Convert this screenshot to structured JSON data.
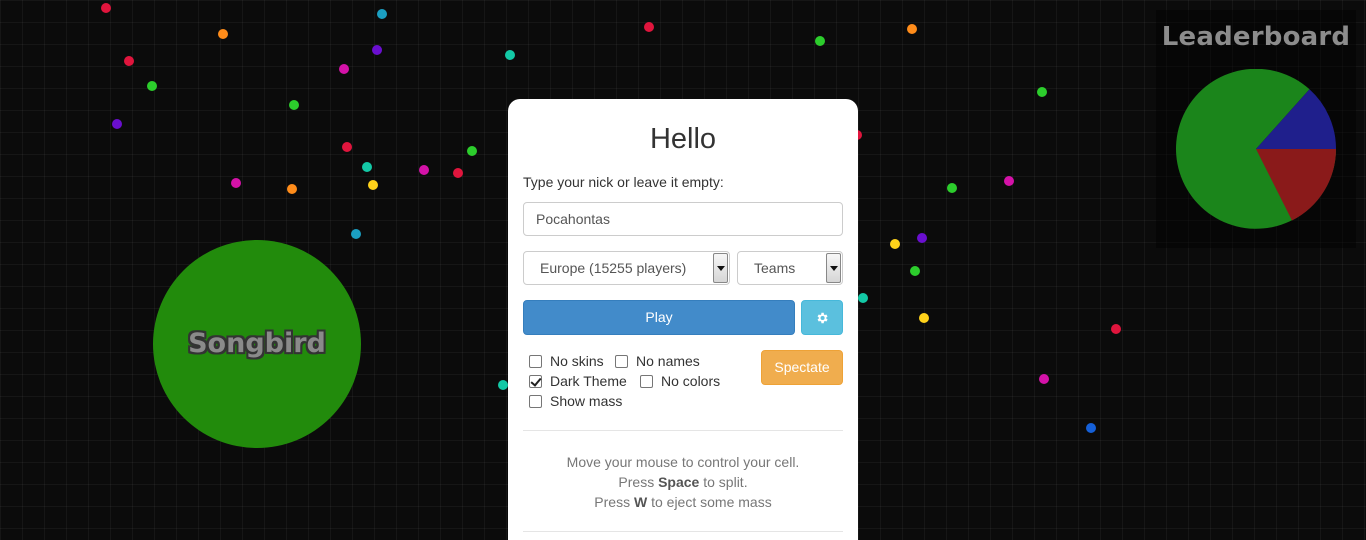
{
  "player_cell": {
    "name": "Songbird",
    "color": "#228b0c"
  },
  "pellet_colors": [
    "#e0153d",
    "#1b9fc2",
    "#ff8c1a",
    "#2ccd2c",
    "#6a0fcf",
    "#d412a8",
    "#1560d8",
    "#ffd21a",
    "#13c9a6"
  ],
  "leaderboard": {
    "title": "Leaderboard",
    "pie_colors": [
      "#1b851b",
      "#1f1f8c",
      "#8a1a1a"
    ]
  },
  "dialog": {
    "title": "Hello",
    "nick_label": "Type your nick or leave it empty:",
    "nick_value": "Pocahontas",
    "region_select": "Europe (15255 players)",
    "mode_select": "Teams",
    "play_label": "Play",
    "settings_icon": "gear-icon",
    "spectate_label": "Spectate",
    "options": {
      "no_skins": {
        "label": "No skins",
        "checked": false
      },
      "no_names": {
        "label": "No names",
        "checked": false
      },
      "dark_theme": {
        "label": "Dark Theme",
        "checked": true
      },
      "no_colors": {
        "label": "No colors",
        "checked": false
      },
      "show_mass": {
        "label": "Show mass",
        "checked": false
      }
    },
    "instructions": {
      "line1": "Move your mouse to control your cell.",
      "line2_pre": "Press ",
      "line2_key": "Space",
      "line2_post": " to split.",
      "line3_pre": "Press ",
      "line3_key": "W",
      "line3_post": " to eject some mass"
    }
  }
}
